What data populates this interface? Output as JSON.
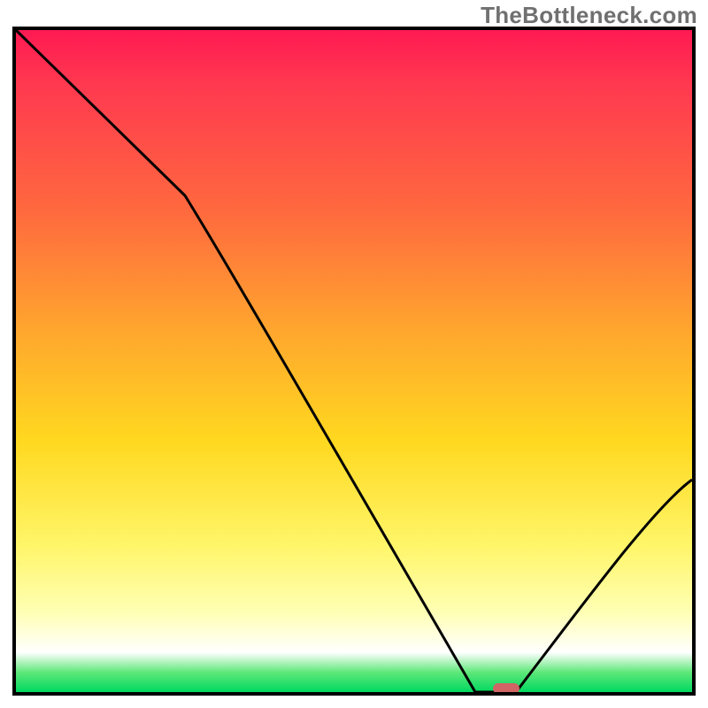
{
  "watermark": "TheBottleneck.com",
  "colors": {
    "border": "#000000",
    "curve": "#000000",
    "marker": "#d16464",
    "gradient_top": "#ff1a52",
    "gradient_bottom": "#00d860"
  },
  "chart_data": {
    "type": "line",
    "title": "",
    "xlabel": "",
    "ylabel": "",
    "xlim": [
      0,
      100
    ],
    "ylim": [
      0,
      100
    ],
    "grid": false,
    "legend": false,
    "series": [
      {
        "name": "bottleneck-curve",
        "x": [
          0,
          25,
          68,
          74,
          100
        ],
        "values": [
          100,
          75,
          0,
          0,
          32
        ]
      }
    ],
    "marker": {
      "x_start": 70.5,
      "x_end": 74.5,
      "y": 0.5
    },
    "gradient_stops": [
      {
        "pos": 0,
        "color": "#ff1a52"
      },
      {
        "pos": 8,
        "color": "#ff3850"
      },
      {
        "pos": 28,
        "color": "#ff6b3e"
      },
      {
        "pos": 45,
        "color": "#ffa52e"
      },
      {
        "pos": 62,
        "color": "#ffd81f"
      },
      {
        "pos": 78,
        "color": "#fff66a"
      },
      {
        "pos": 88,
        "color": "#ffffb5"
      },
      {
        "pos": 94,
        "color": "#ffffff"
      },
      {
        "pos": 97,
        "color": "#5fe87a"
      },
      {
        "pos": 100,
        "color": "#00d860"
      }
    ]
  }
}
